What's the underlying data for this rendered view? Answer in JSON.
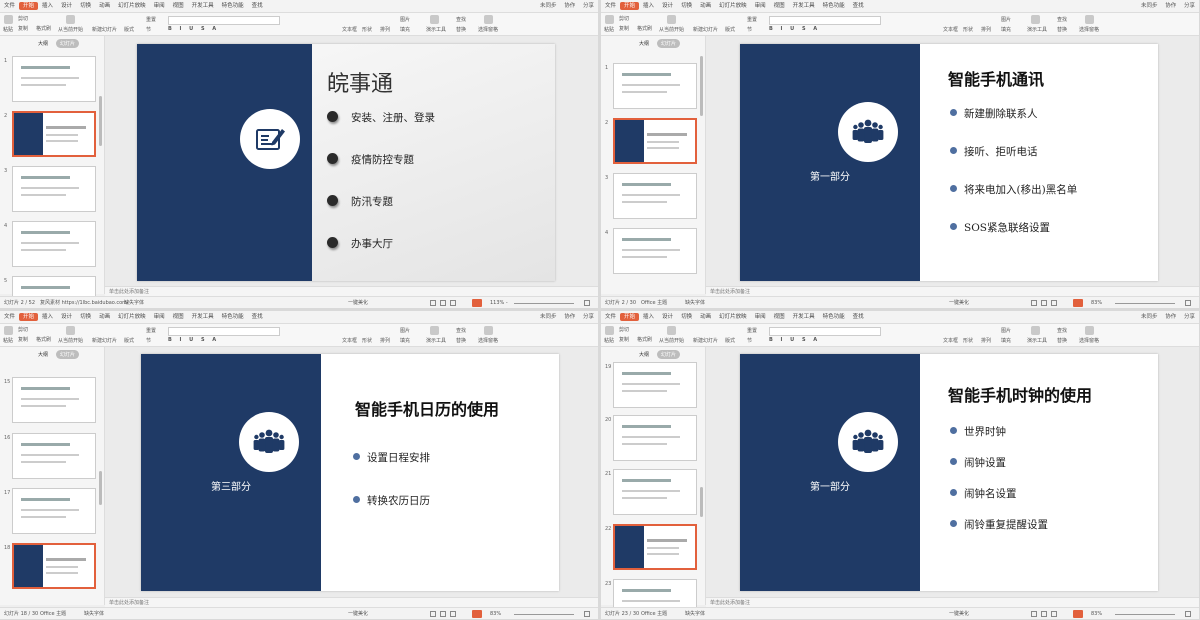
{
  "menu": {
    "file": "文件",
    "start": "开始",
    "tabs": [
      "插入",
      "设计",
      "切换",
      "动画",
      "幻灯片放映",
      "审阅",
      "视图",
      "开发工具",
      "特色功能"
    ],
    "search": "查找",
    "right": [
      "未同步",
      "协作",
      "分享"
    ]
  },
  "ribbon": {
    "paste": "粘贴",
    "cut": "剪切",
    "copy": "复制",
    "format_painter": "格式刷",
    "from_current": "从当前开始",
    "new_slide": "新建幻灯片",
    "layout": "版式",
    "reset": "重置",
    "section": "节",
    "textbox": "文本框",
    "shape": "形状",
    "arrange": "排列",
    "picture": "图片",
    "fill": "填充",
    "find": "查找",
    "replace": "替换",
    "select_pane": "选择窗格",
    "presenter": "演示工具"
  },
  "panel": {
    "outline_tab": "大纲",
    "slide_tab": "幻灯片"
  },
  "notes_placeholder": "单击此处添加备注",
  "windows": [
    {
      "status": {
        "slide": "幻灯片 2 / 52",
        "theme": "复风素材 https://1lbc.baidubao.com/",
        "font_missing": "缺失字体",
        "beautify": "一键美化",
        "zoom": "113% -"
      },
      "thumb_nums": [
        "1",
        "2",
        "3",
        "4",
        "5"
      ],
      "slide": {
        "title": "皖事通",
        "bullets": [
          "安装、注册、登录",
          "疫情防控专题",
          "防汛专题",
          "办事大厅"
        ]
      }
    },
    {
      "status": {
        "slide": "幻灯片 2 / 30",
        "theme": "Office 主题",
        "font_missing": "缺失字体",
        "beautify": "一键美化",
        "zoom": "83%"
      },
      "thumb_nums": [
        "1",
        "2",
        "3",
        "4"
      ],
      "slide": {
        "section": "第一部分",
        "title": "智能手机通讯",
        "bullets": [
          "新建删除联系人",
          "接听、拒听电话",
          "将来电加入(移出)黑名单",
          "SOS紧急联络设置"
        ]
      }
    },
    {
      "status": {
        "slide": "幻灯片 18 / 30",
        "theme": "Office 主题",
        "font_missing": "缺失字体",
        "beautify": "一键美化",
        "zoom": "83%"
      },
      "thumb_nums": [
        "15",
        "16",
        "17",
        "18"
      ],
      "slide": {
        "section": "第三部分",
        "title": "智能手机日历的使用",
        "bullets": [
          "设置日程安排",
          "转换农历日历"
        ]
      }
    },
    {
      "status": {
        "slide": "幻灯片 23 / 30",
        "theme": "Office 主题",
        "font_missing": "缺失字体",
        "beautify": "一键美化",
        "zoom": "83%"
      },
      "thumb_nums": [
        "19",
        "20",
        "21",
        "22",
        "23"
      ],
      "slide": {
        "section": "第一部分",
        "title": "智能手机时钟的使用",
        "bullets": [
          "世界时钟",
          "闹钟设置",
          "闹钟名设置",
          "闹铃重复提醒设置"
        ]
      }
    }
  ],
  "colors": {
    "navy": "#1f3a66",
    "accent": "#e2603c",
    "bullet": "#4f6fa0"
  }
}
